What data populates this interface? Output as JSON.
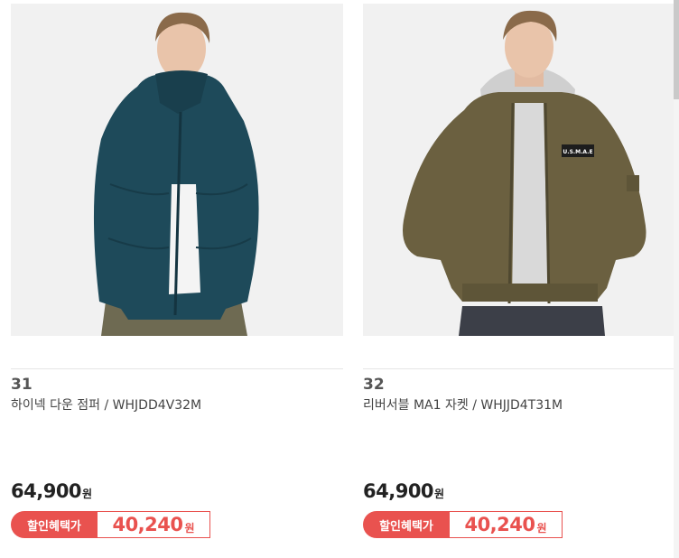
{
  "products": [
    {
      "number": "31",
      "name": "하이넥 다운 점퍼 / WHJDD4V32M",
      "price": "64,900",
      "price_unit": "원",
      "sale_label": "할인혜택가",
      "sale_price": "40,240",
      "sale_unit": "원",
      "image": "navy-high-neck-down-jacket",
      "jacket_color": "#1e4a5a"
    },
    {
      "number": "32",
      "name": "리버서블 MA1 자켓 / WHJJD4T31M",
      "price": "64,900",
      "price_unit": "원",
      "sale_label": "할인혜택가",
      "sale_price": "40,240",
      "sale_unit": "원",
      "image": "olive-reversible-ma1-jacket",
      "jacket_color": "#6b6040",
      "patch_text": "U.S.M.A.E"
    }
  ],
  "colors": {
    "sale_accent": "#e9524f",
    "price_text": "#222222"
  }
}
